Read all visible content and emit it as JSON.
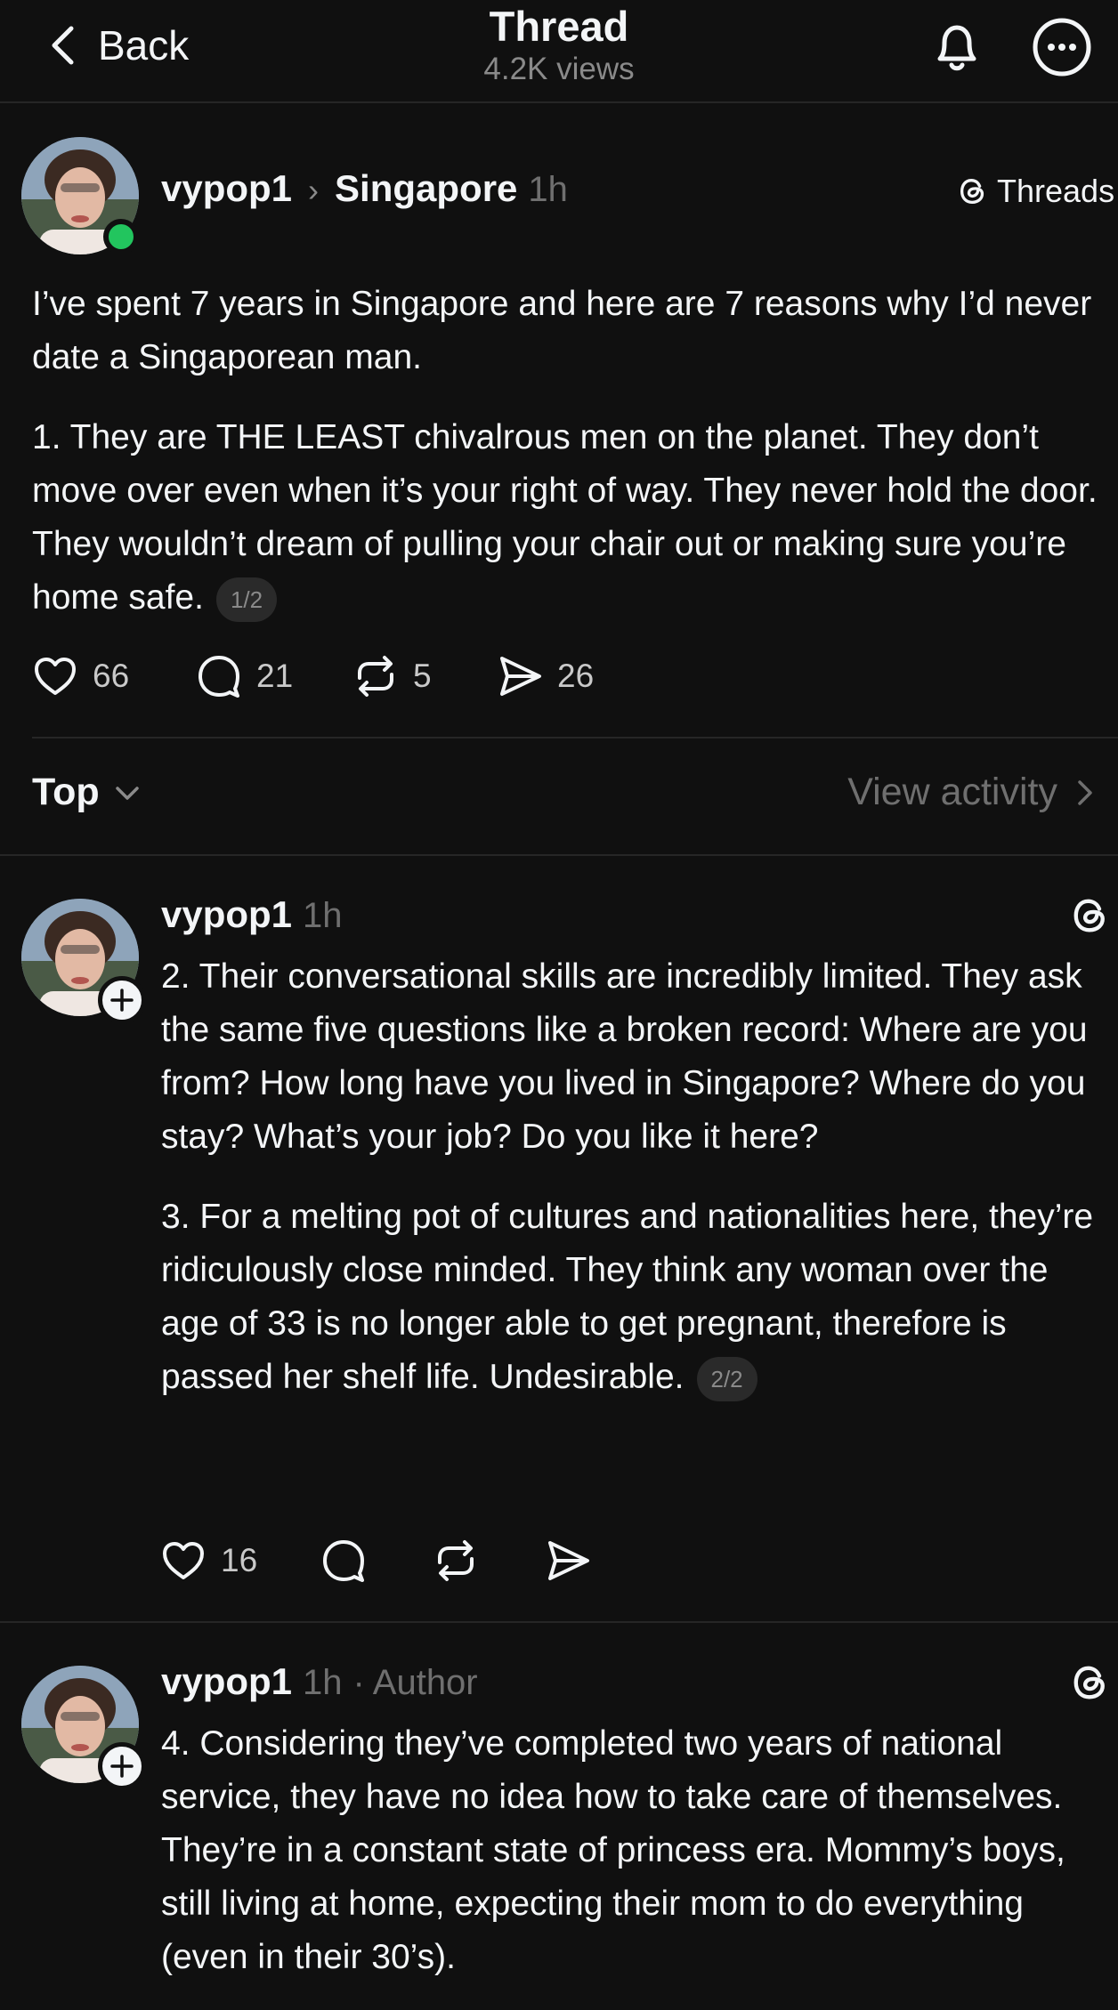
{
  "header": {
    "back_label": "Back",
    "title": "Thread",
    "views": "4.2K views"
  },
  "post": {
    "username": "vypop1",
    "topic": "Singapore",
    "time": "1h",
    "source_label": "Threads",
    "paragraphs": [
      "I’ve spent 7 years in Singapore and here are 7 reasons why I’d never date a Singaporean man.",
      "1. They are THE LEAST chivalrous men on the planet. They don’t move over even when it’s your right of way. They never hold the door. They wouldn’t dream of pulling your chair out or making sure you’re home safe."
    ],
    "page_indicator": "1/2",
    "likes": "66",
    "replies": "21",
    "reposts": "5",
    "shares": "26"
  },
  "sort": {
    "label": "Top",
    "view_activity": "View activity"
  },
  "reply1": {
    "username": "vypop1",
    "time": "1h",
    "paragraphs": [
      "2. Their conversational skills are incredibly limited. They ask the same five questions like a broken record: Where are you from? How long have you lived in Singapore? Where do you stay? What’s your job? Do you like it here?",
      "3. For a melting pot of cultures and nationalities here, they’re ridiculously close minded. They think any woman over the age of 33 is no longer able to get pregnant, therefore is passed her shelf life. Undesirable."
    ],
    "page_indicator": "2/2",
    "likes": "16"
  },
  "reply2": {
    "username": "vypop1",
    "time": "1h",
    "author_tag": "· Author",
    "paragraphs": [
      "4. Considering they’ve completed two years of national service, they have no idea how to take care of themselves. They’re in a constant state of princess era. Mommy’s boys, still living at home, expecting their mom to do everything (even in their 30’s)."
    ]
  },
  "colors": {
    "background": "#101010",
    "text": "#f3f5f7",
    "secondary": "#6f6f6f",
    "online": "#22c55e"
  }
}
